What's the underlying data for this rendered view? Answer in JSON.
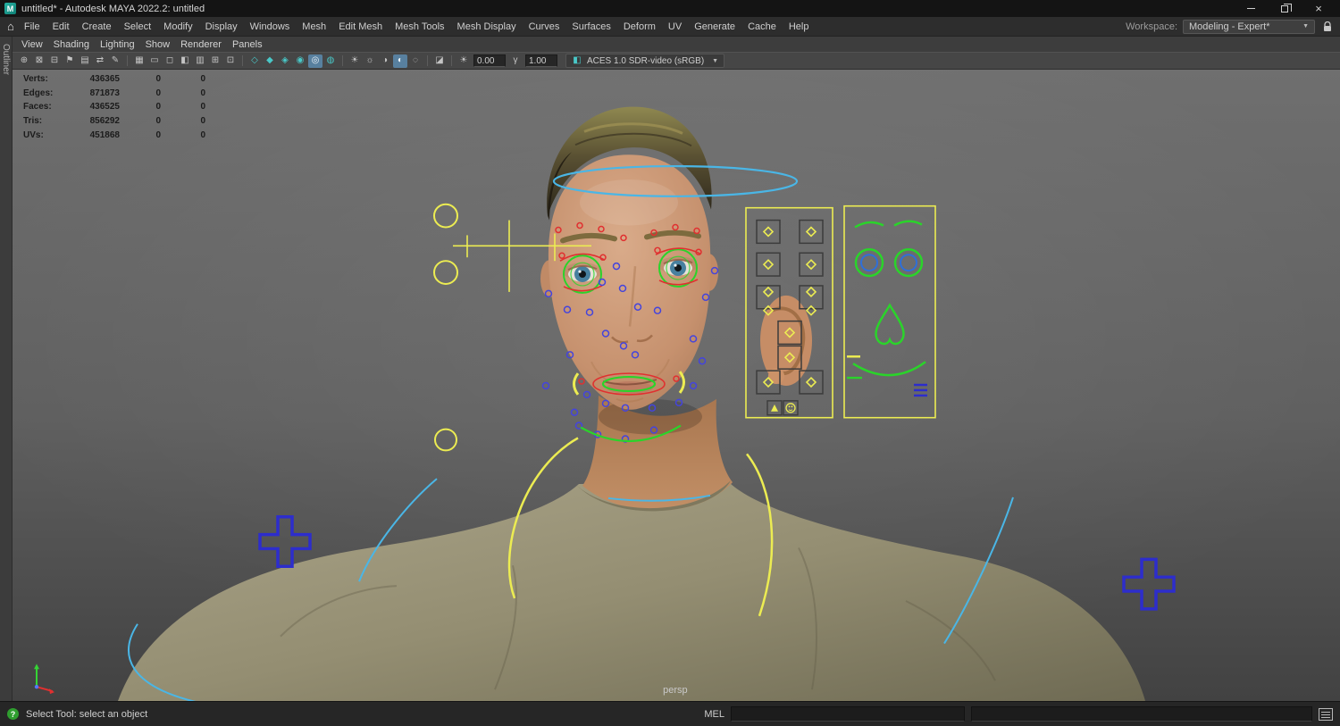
{
  "window": {
    "title": "untitled* - Autodesk MAYA 2022.2: untitled",
    "app_initial": "M"
  },
  "menu_bar": {
    "home_glyph": "⌂",
    "items": [
      "File",
      "Edit",
      "Create",
      "Select",
      "Modify",
      "Display",
      "Windows",
      "Mesh",
      "Edit Mesh",
      "Mesh Tools",
      "Mesh Display",
      "Curves",
      "Surfaces",
      "Deform",
      "UV",
      "Generate",
      "Cache",
      "Help"
    ],
    "workspace_label": "Workspace:",
    "workspace_value": "Modeling - Expert*",
    "workspace_caret": "▼"
  },
  "panel_menu": {
    "items": [
      "View",
      "Shading",
      "Lighting",
      "Show",
      "Renderer",
      "Panels"
    ]
  },
  "panel_toolbar": {
    "icons": [
      {
        "name": "select-camera-icon",
        "glyph": "⊕"
      },
      {
        "name": "lock-camera-icon",
        "glyph": "⊠"
      },
      {
        "name": "camera-attributes-icon",
        "glyph": "⊟"
      },
      {
        "name": "bookmarks-icon",
        "glyph": "⚑"
      },
      {
        "name": "image-plane-icon",
        "glyph": "▤"
      },
      {
        "name": "two-d-pan-zoom-icon",
        "glyph": "⇄"
      },
      {
        "name": "grease-pencil-icon",
        "glyph": "✎"
      },
      {
        "name": "grid-icon",
        "glyph": "▦"
      },
      {
        "name": "film-gate-icon",
        "glyph": "▭"
      },
      {
        "name": "resolution-gate-icon",
        "glyph": "◻"
      },
      {
        "name": "gate-mask-icon",
        "glyph": "◧"
      },
      {
        "name": "field-chart-icon",
        "glyph": "▥"
      },
      {
        "name": "safe-action-icon",
        "glyph": "⊞"
      },
      {
        "name": "safe-title-icon",
        "glyph": "⊡"
      },
      {
        "name": "wireframe-icon",
        "glyph": "◇"
      },
      {
        "name": "shaded-icon",
        "glyph": "◆"
      },
      {
        "name": "textured-icon",
        "glyph": "◈"
      },
      {
        "name": "wireframe-on-shaded-icon",
        "glyph": "◉"
      },
      {
        "name": "xray-icon",
        "glyph": "◎"
      },
      {
        "name": "default-material-icon",
        "glyph": "◍"
      },
      {
        "name": "use-default-lighting-icon",
        "glyph": "☀"
      },
      {
        "name": "use-all-lights-icon",
        "glyph": "☼"
      },
      {
        "name": "shadows-icon",
        "glyph": "◑"
      },
      {
        "name": "screen-space-ao-icon",
        "glyph": "◐"
      },
      {
        "name": "motion-blur-icon",
        "glyph": "◌"
      },
      {
        "name": "isolate-select-icon",
        "glyph": "◪"
      }
    ],
    "exposure_icon": "☀",
    "exposure_value": "0.00",
    "gamma_icon": "γ",
    "gamma_value": "1.00",
    "view_transform_icon": "◧",
    "colorspace_value": "ACES 1.0 SDR-video (sRGB)",
    "colorspace_caret": "▼"
  },
  "outliner_tab": {
    "label": "Outliner"
  },
  "hud": {
    "rows": [
      {
        "label": "Verts:",
        "value": "436365",
        "selected": "0",
        "other": "0"
      },
      {
        "label": "Edges:",
        "value": "871873",
        "selected": "0",
        "other": "0"
      },
      {
        "label": "Faces:",
        "value": "436525",
        "selected": "0",
        "other": "0"
      },
      {
        "label": "Tris:",
        "value": "856292",
        "selected": "0",
        "other": "0"
      },
      {
        "label": "UVs:",
        "value": "451868",
        "selected": "0",
        "other": "0"
      }
    ]
  },
  "viewport": {
    "camera_label": "persp"
  },
  "status_bar": {
    "help_glyph": "?",
    "tool_hint": "Select Tool: select an object",
    "mel_label": "MEL",
    "mel_input_value": "",
    "result_input_value": ""
  },
  "colors": {
    "rig_yellow": "#ecec52",
    "rig_green": "#2ad42a",
    "rig_red": "#e03030",
    "rig_blue": "#2d2dcc",
    "rig_cyan": "#4ab6e6",
    "active_icon_bg": "#58809f"
  }
}
